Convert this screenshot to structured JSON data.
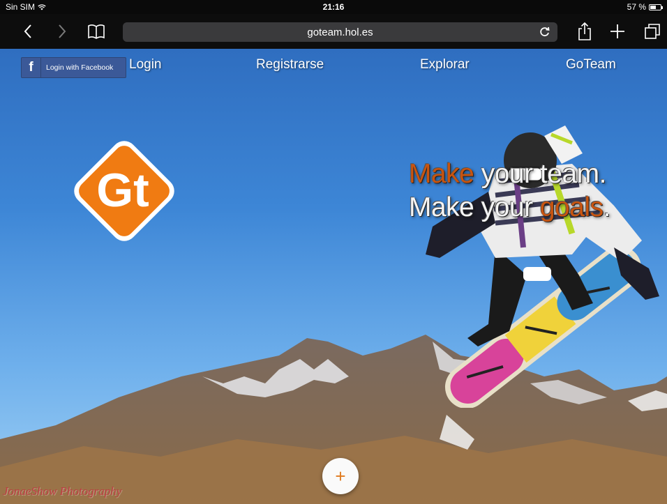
{
  "status_bar": {
    "carrier": "Sin SIM",
    "time": "21:16",
    "battery": "57 %",
    "battery_level": 0.57
  },
  "browser": {
    "url": "goteam.hol.es",
    "icons": {
      "back": "chevron-left-icon",
      "forward": "chevron-right-icon",
      "bookmarks": "book-icon",
      "reload": "reload-icon",
      "share": "share-icon",
      "new_tab": "plus-icon",
      "tabs": "tabs-icon"
    }
  },
  "page": {
    "facebook_login": {
      "icon": "f",
      "label": "Login with Facebook"
    },
    "nav": {
      "login": "Login",
      "registrarse": "Registrarse",
      "explorar": "Explorar",
      "goteam": "GoTeam"
    },
    "logo": {
      "text": "Gt",
      "color": "#f07b12"
    },
    "tagline": {
      "line1_accent": "Make",
      "line1_rest": " your team.",
      "line2_start": "Make your ",
      "line2_accent": "goals",
      "line2_end": ".",
      "accent_color": "#c85410"
    },
    "add_button": "+",
    "watermark": "JonaeShow Photography"
  }
}
